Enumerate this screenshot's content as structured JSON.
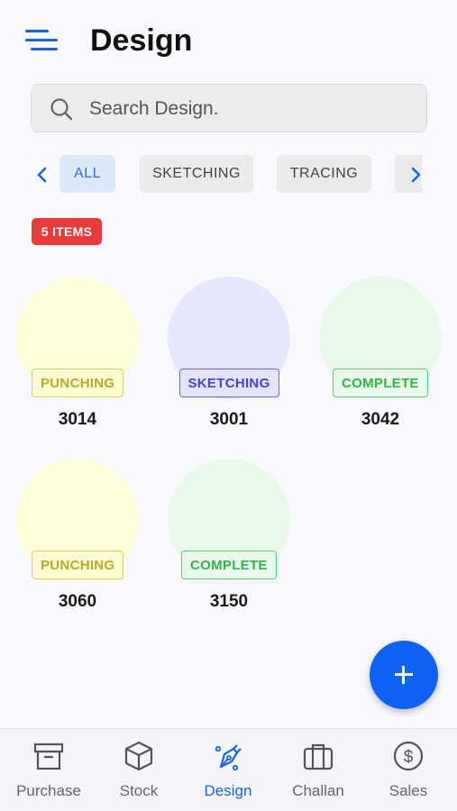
{
  "header": {
    "title": "Design",
    "menu_icon": "menu-icon"
  },
  "search": {
    "placeholder": "Search Design.",
    "value": ""
  },
  "filters": {
    "chips": [
      "ALL",
      "SKETCHING",
      "TRACING"
    ],
    "selected": "ALL"
  },
  "count_badge": "5 ITEMS",
  "designs": [
    {
      "status": "PUNCHING",
      "code": "3014"
    },
    {
      "status": "SKETCHING",
      "code": "3001"
    },
    {
      "status": "COMPLETE",
      "code": "3042"
    },
    {
      "status": "PUNCHING",
      "code": "3060"
    },
    {
      "status": "COMPLETE",
      "code": "3150"
    }
  ],
  "status_colors": {
    "PUNCHING": {
      "circle": "#fefdd9",
      "border": "#d8cf6a",
      "text": "#b8a92a",
      "bg": "#fdfbd0"
    },
    "SKETCHING": {
      "circle": "#e6e7fd",
      "border": "#6a6ad6",
      "text": "#4545c8",
      "bg": "#e3e4fb"
    },
    "COMPLETE": {
      "circle": "#eaf8ea",
      "border": "#5fce6e",
      "text": "#2db54a",
      "bg": "#eaf8ea"
    }
  },
  "fab": {
    "icon": "plus-icon"
  },
  "tabbar": {
    "items": [
      {
        "label": "Purchase",
        "icon": "archive-box-icon"
      },
      {
        "label": "Stock",
        "icon": "cube-icon"
      },
      {
        "label": "Design",
        "icon": "pen-nib-icon",
        "active": true
      },
      {
        "label": "Challan",
        "icon": "briefcase-icon"
      },
      {
        "label": "Sales",
        "icon": "dollar-circle-icon"
      }
    ]
  },
  "accent_color": "#1565e6"
}
